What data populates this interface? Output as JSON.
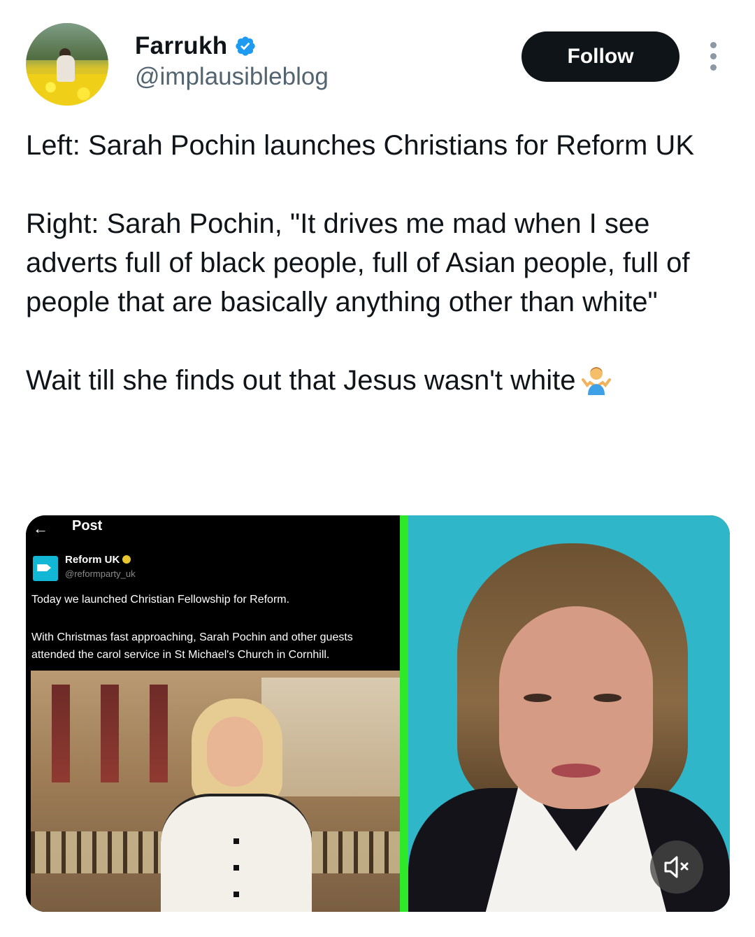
{
  "user": {
    "name": "Farrukh",
    "handle": "@implausibleblog",
    "verified_color": "#1d9bf0",
    "avatar_icon": "profile-photo"
  },
  "actions": {
    "follow_label": "Follow",
    "more_icon": "more-vertical-icon"
  },
  "tweet": {
    "paragraphs": [
      "Left: Sarah Pochin launches Christians for Reform UK",
      "Right: Sarah Pochin, \"It drives me mad when I see adverts full of black people, full of Asian people, full of people that are basically anything other than white\"",
      "Wait till she finds out that Jesus wasn't white"
    ],
    "emoji": "person-shrugging"
  },
  "media": {
    "left": {
      "nav_title": "Post",
      "back_icon": "back-arrow-icon",
      "account_name": "Reform UK",
      "account_handle": "@reformparty_uk",
      "text_line1": "Today we launched Christian Fellowship for Reform.",
      "text_line2": "With Christmas fast approaching, Sarah Pochin and other guests attended the carol service in St Michael's Church in Cornhill."
    },
    "divider_color": "#2ee82a",
    "right_bg_color": "#2fb6c9",
    "mute_icon": "speaker-muted-icon"
  }
}
